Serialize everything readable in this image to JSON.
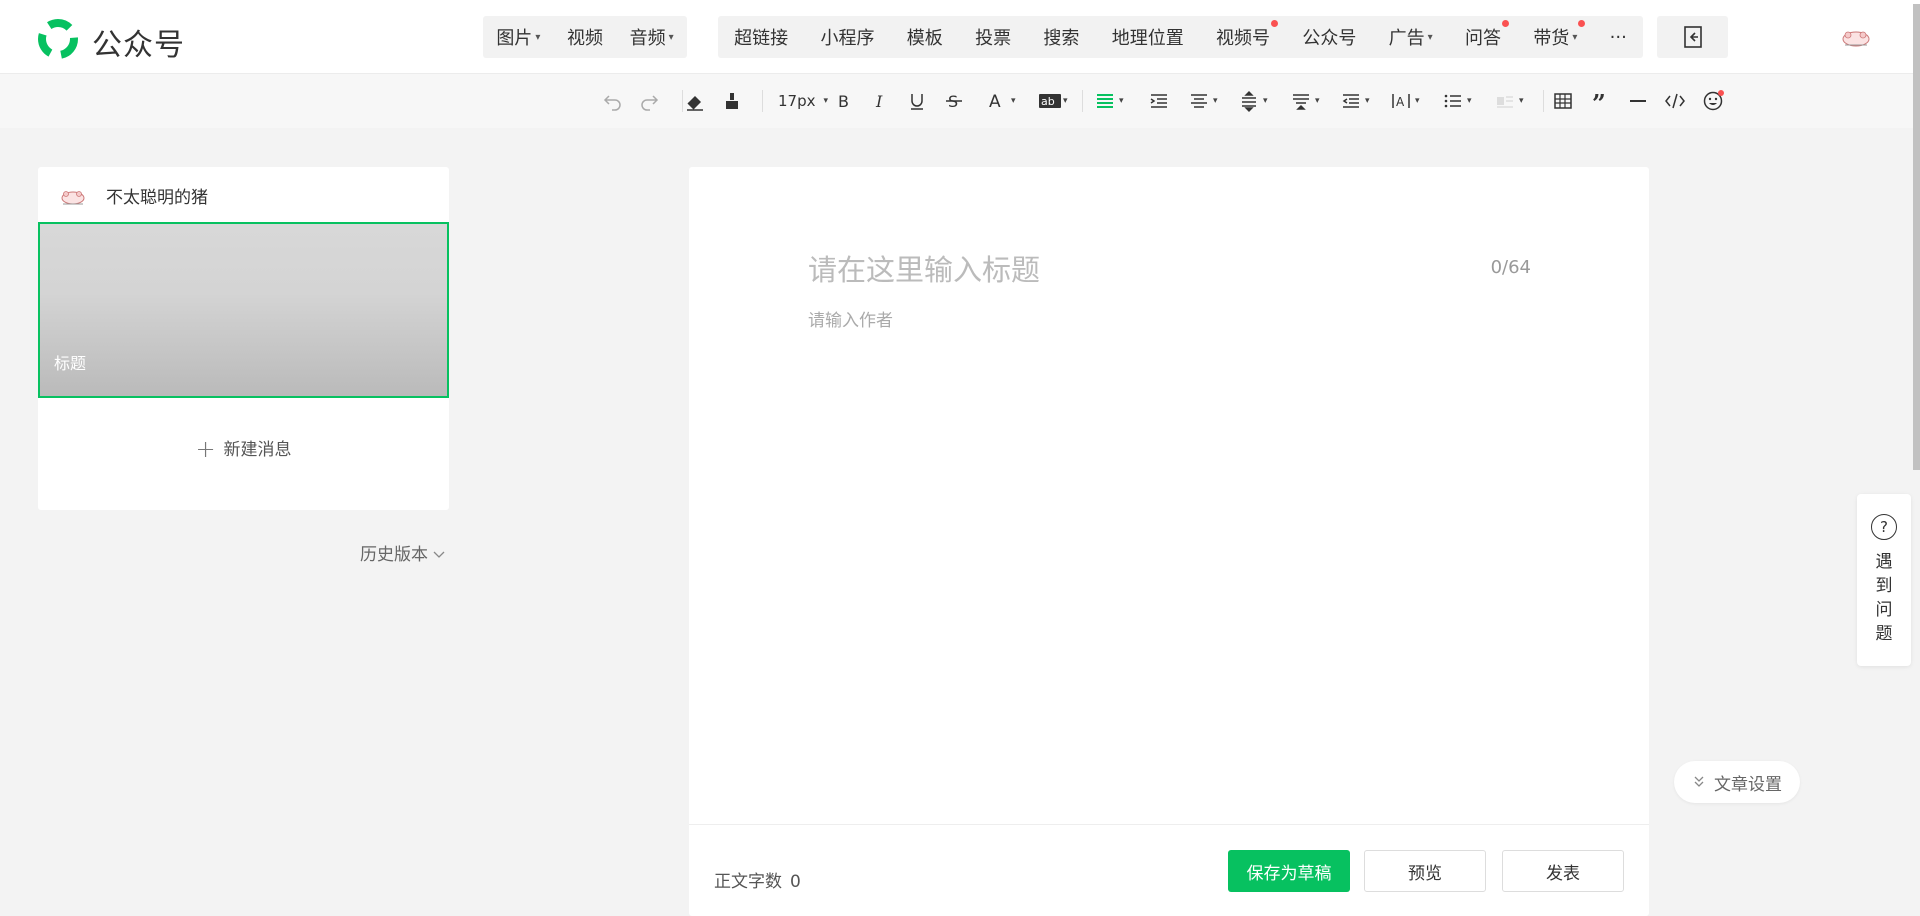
{
  "brand": {
    "name": "公众号",
    "accent": "#07c160"
  },
  "nav": {
    "media": [
      {
        "label": "图片",
        "caret": true
      },
      {
        "label": "视频",
        "caret": false
      },
      {
        "label": "音频",
        "caret": true
      }
    ],
    "insert": [
      {
        "label": "超链接",
        "caret": false,
        "dot": false
      },
      {
        "label": "小程序",
        "caret": false,
        "dot": false
      },
      {
        "label": "模板",
        "caret": false,
        "dot": false
      },
      {
        "label": "投票",
        "caret": false,
        "dot": false
      },
      {
        "label": "搜索",
        "caret": false,
        "dot": false
      },
      {
        "label": "地理位置",
        "caret": false,
        "dot": false
      },
      {
        "label": "视频号",
        "caret": false,
        "dot": true
      },
      {
        "label": "公众号",
        "caret": false,
        "dot": false
      },
      {
        "label": "广告",
        "caret": true,
        "dot": false
      },
      {
        "label": "问答",
        "caret": false,
        "dot": true
      },
      {
        "label": "带货",
        "caret": true,
        "dot": true
      }
    ],
    "more_label": "···",
    "exit_icon": "exit-editor-icon"
  },
  "toolbar": {
    "font_size": "17px",
    "icons": [
      "undo-icon",
      "redo-icon",
      "clear-format-icon",
      "format-painter-icon",
      "font-size-select",
      "bold-icon",
      "italic-icon",
      "underline-icon",
      "strikethrough-icon",
      "font-color-icon",
      "background-color-icon",
      "align-justify-icon",
      "indent-icon",
      "align-center-icon",
      "line-height-icon",
      "paragraph-spacing-icon",
      "outdent-icon",
      "letter-spacing-icon",
      "list-icon",
      "float-icon",
      "table-icon",
      "quote-icon",
      "divider-icon",
      "code-icon",
      "emoji-icon"
    ]
  },
  "account": {
    "name": "不太聪明的猪"
  },
  "article_list": {
    "cover_title": "标题",
    "new_message": "新建消息",
    "history": "历史版本"
  },
  "editor": {
    "title_placeholder": "请在这里输入标题",
    "title_count": "0/64",
    "author_placeholder": "请输入作者",
    "word_count_label": "正文字数",
    "word_count": "0"
  },
  "actions": {
    "save_draft": "保存为草稿",
    "preview": "预览",
    "publish": "发表"
  },
  "article_settings": "文章设置",
  "help": {
    "icon_text": "?",
    "label": "遇到问题"
  }
}
